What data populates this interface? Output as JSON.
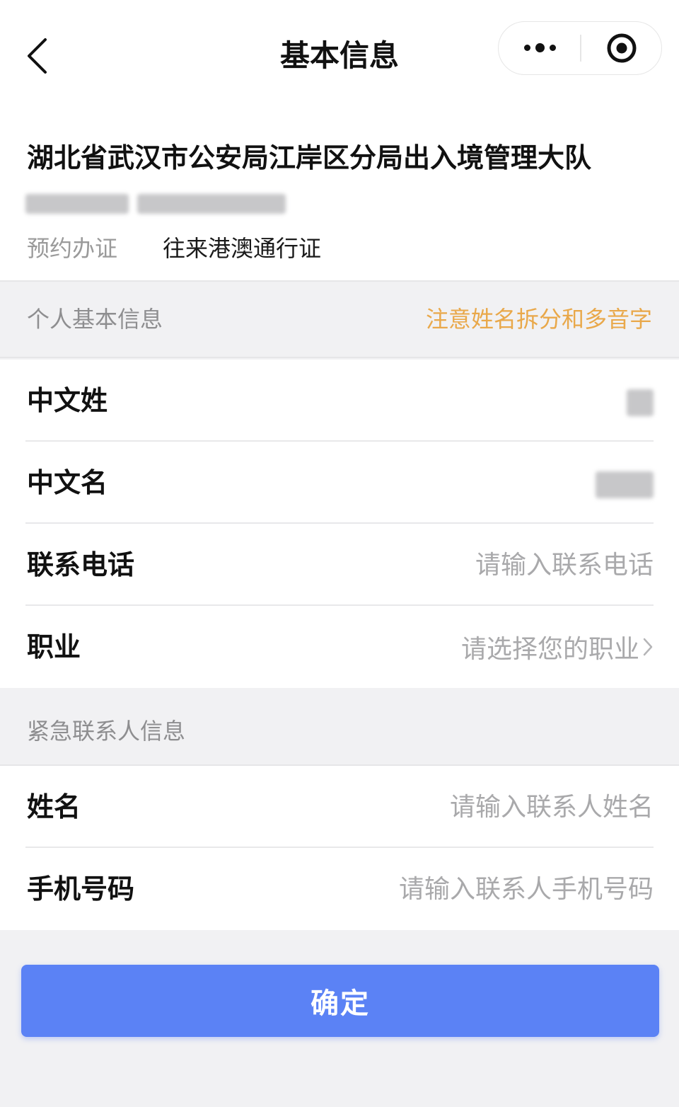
{
  "nav": {
    "title": "基本信息"
  },
  "office": {
    "name": "湖北省武汉市公安局江岸区分局出入境管理大队",
    "service_label": "预约办证",
    "service_value": "往来港澳通行证"
  },
  "personal_section": {
    "title": "个人基本信息",
    "note": "注意姓名拆分和多音字",
    "rows": [
      {
        "label": "中文姓"
      },
      {
        "label": "中文名"
      },
      {
        "label": "联系电话",
        "placeholder": "请输入联系电话"
      },
      {
        "label": "职业",
        "placeholder": "请选择您的职业"
      }
    ]
  },
  "emergency_section": {
    "title": "紧急联系人信息",
    "rows": [
      {
        "label": "姓名",
        "placeholder": "请输入联系人姓名"
      },
      {
        "label": "手机号码",
        "placeholder": "请输入联系人手机号码"
      }
    ]
  },
  "confirm_label": "确定",
  "colors": {
    "accent": "#5b82f5",
    "note": "#e9a84a",
    "placeholder": "#a9a9ab",
    "section_bg": "#f1f1f3"
  }
}
